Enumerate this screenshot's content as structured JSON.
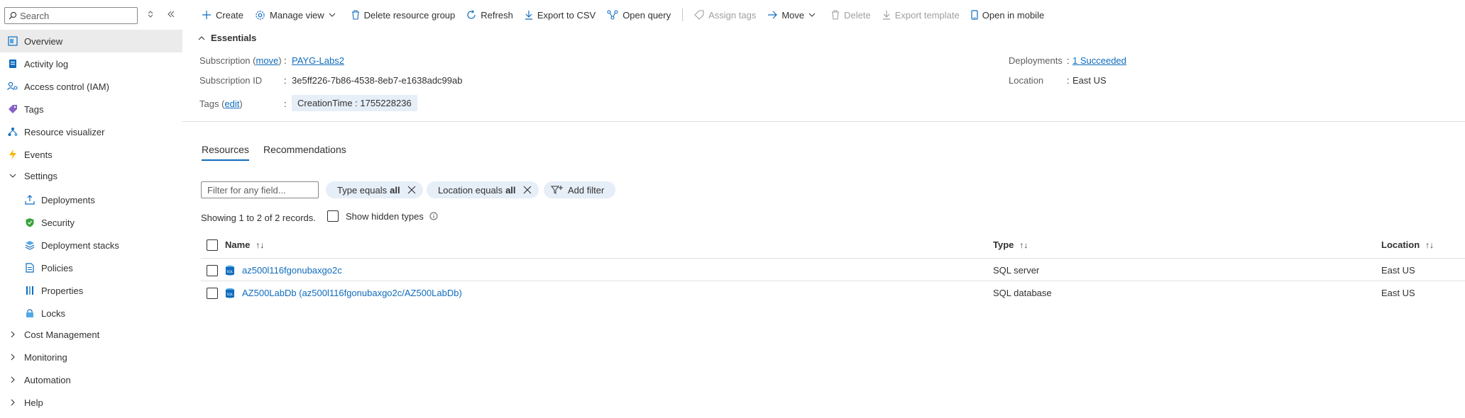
{
  "sidebar": {
    "search_placeholder": "Search",
    "items": [
      {
        "label": "Overview",
        "icon": "overview-icon"
      },
      {
        "label": "Activity log",
        "icon": "activity-log-icon"
      },
      {
        "label": "Access control (IAM)",
        "icon": "iam-icon"
      },
      {
        "label": "Tags",
        "icon": "tag-icon"
      },
      {
        "label": "Resource visualizer",
        "icon": "resource-visualizer-icon"
      },
      {
        "label": "Events",
        "icon": "events-icon"
      },
      {
        "label": "Settings",
        "icon": "chevron-down-icon"
      },
      {
        "label": "Deployments",
        "icon": "deployments-icon"
      },
      {
        "label": "Security",
        "icon": "shield-icon"
      },
      {
        "label": "Deployment stacks",
        "icon": "stack-icon"
      },
      {
        "label": "Policies",
        "icon": "policies-icon"
      },
      {
        "label": "Properties",
        "icon": "properties-icon"
      },
      {
        "label": "Locks",
        "icon": "lock-icon"
      },
      {
        "label": "Cost Management",
        "icon": "chevron-right-icon"
      },
      {
        "label": "Monitoring",
        "icon": "chevron-right-icon"
      },
      {
        "label": "Automation",
        "icon": "chevron-right-icon"
      },
      {
        "label": "Help",
        "icon": "chevron-right-icon"
      }
    ]
  },
  "toolbar": {
    "create": "Create",
    "manage_view": "Manage view",
    "delete_rg": "Delete resource group",
    "refresh": "Refresh",
    "export_csv": "Export to CSV",
    "open_query": "Open query",
    "assign_tags": "Assign tags",
    "move": "Move",
    "delete": "Delete",
    "export_template": "Export template",
    "open_mobile": "Open in mobile"
  },
  "essentials": {
    "title": "Essentials",
    "subscription_label": "Subscription (",
    "subscription_move": "move",
    "subscription_label_end": ")",
    "subscription_value": "PAYG-Labs2",
    "subscription_id_label": "Subscription ID",
    "subscription_id_value": "3e5ff226-7b86-4538-8eb7-e1638adc99ab",
    "tags_label": "Tags (",
    "tags_edit": "edit",
    "tags_label_end": ")",
    "tag_chip": "CreationTime : 1755228236",
    "deployments_label": "Deployments",
    "deployments_value": "1 Succeeded",
    "location_label": "Location",
    "location_value": "East US",
    "colon": ":"
  },
  "tabs": [
    "Resources",
    "Recommendations"
  ],
  "filters": {
    "input_placeholder": "Filter for any field...",
    "type_pill_prefix": "Type equals",
    "type_pill_value": "all",
    "location_pill_prefix": "Location equals",
    "location_pill_value": "all",
    "add_filter": "Add filter"
  },
  "records_text": "Showing 1 to 2 of 2 records.",
  "show_hidden_types": "Show hidden types",
  "table": {
    "columns": [
      "Name",
      "Type",
      "Location"
    ],
    "sort_glyph": "↑↓",
    "rows": [
      {
        "name": "az500l116fgonubaxgo2c",
        "type": "SQL server",
        "location": "East US"
      },
      {
        "name": "AZ500LabDb (az500l116fgonubaxgo2c/AZ500LabDb)",
        "type": "SQL database",
        "location": "East US"
      }
    ]
  },
  "colors": {
    "accent": "#0f6cbd",
    "selected_nav": "#ebebeb",
    "chip_bg": "#e6eef8"
  }
}
